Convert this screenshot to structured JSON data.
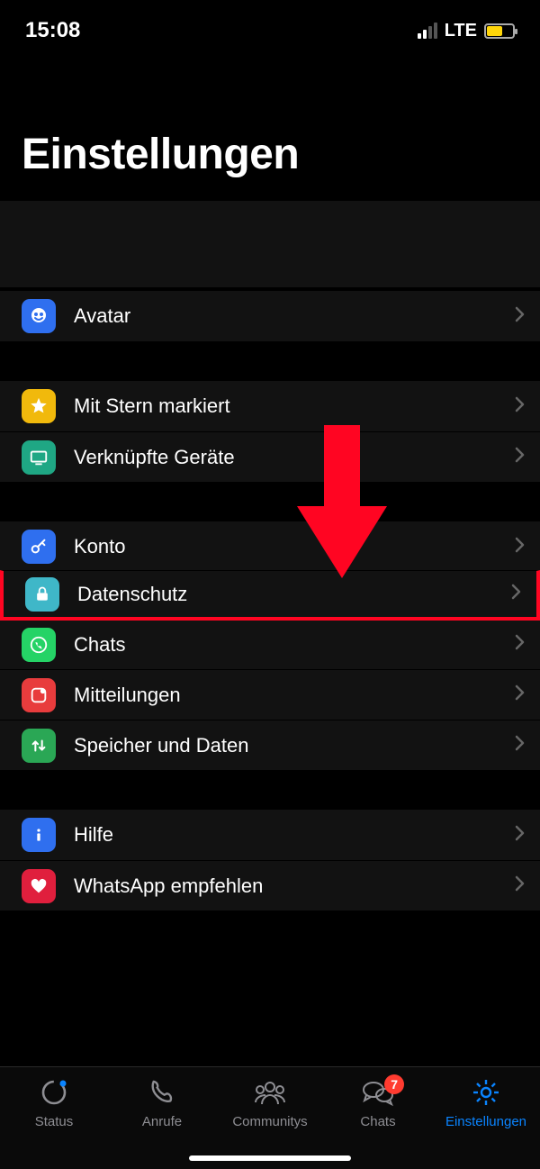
{
  "status": {
    "time": "15:08",
    "network": "LTE"
  },
  "title": "Einstellungen",
  "groups": [
    {
      "items": [
        {
          "key": "avatar",
          "label": "Avatar"
        }
      ]
    },
    {
      "items": [
        {
          "key": "starred",
          "label": "Mit Stern markiert"
        },
        {
          "key": "linked",
          "label": "Verknüpfte Geräte"
        }
      ]
    },
    {
      "items": [
        {
          "key": "account",
          "label": "Konto"
        },
        {
          "key": "privacy",
          "label": "Datenschutz",
          "highlighted": true
        },
        {
          "key": "chats",
          "label": "Chats"
        },
        {
          "key": "notifications",
          "label": "Mitteilungen"
        },
        {
          "key": "storage",
          "label": "Speicher und Daten"
        }
      ]
    },
    {
      "items": [
        {
          "key": "help",
          "label": "Hilfe"
        },
        {
          "key": "tell",
          "label": "WhatsApp empfehlen"
        }
      ]
    }
  ],
  "tabs": {
    "status": "Status",
    "calls": "Anrufe",
    "communities": "Communitys",
    "chats": "Chats",
    "settings": "Einstellungen",
    "chats_badge": "7",
    "active": "settings"
  }
}
